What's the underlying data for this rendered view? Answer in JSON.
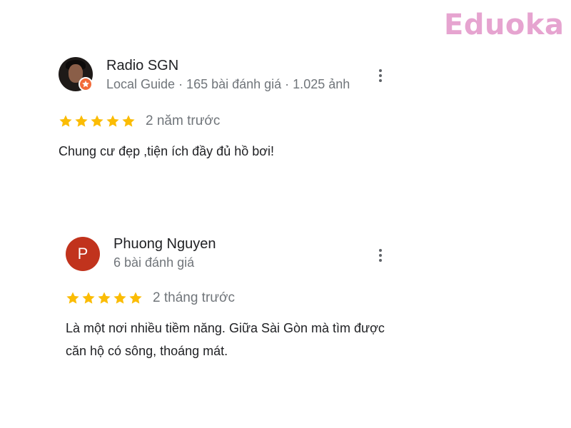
{
  "brand": {
    "logo_text": "Eduoka",
    "color": "#e6a4d0"
  },
  "reviews": [
    {
      "name": "Radio SGN",
      "meta": "Local Guide · 165 bài đánh giá · 1.025 ảnh",
      "rating": 5,
      "date": "2 năm trước",
      "text": "Chung cư đẹp ,tiện ích đầy đủ hồ bơi!",
      "avatar_type": "photo",
      "badge_icon": "local-guide-star-icon"
    },
    {
      "name": "Phuong Nguyen",
      "meta": "6 bài đánh giá",
      "rating": 5,
      "date": "2 tháng trước",
      "text": "Là một nơi nhiều tiềm năng. Giữa Sài Gòn mà tìm được căn hộ có sông, thoáng mát.",
      "avatar_type": "letter",
      "avatar_letter": "P",
      "avatar_color": "#c1331d"
    }
  ],
  "colors": {
    "star": "#fbbc04",
    "meta": "#70757a",
    "text": "#202124"
  },
  "icons": {
    "more": "more-vert-icon",
    "star": "star-icon"
  }
}
